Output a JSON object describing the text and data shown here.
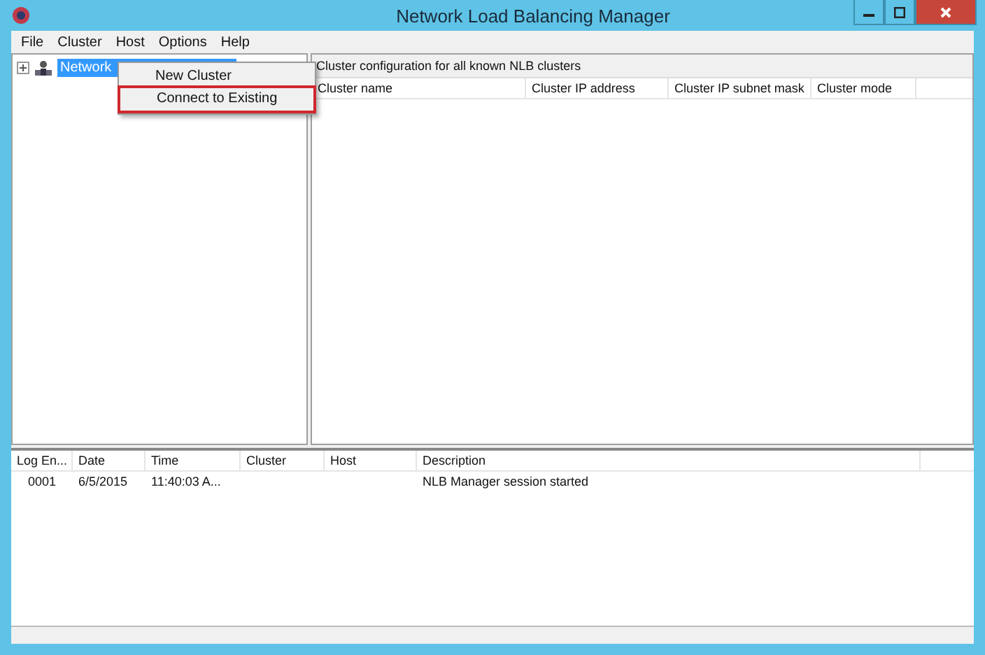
{
  "window": {
    "title": "Network Load Balancing Manager"
  },
  "menu_bar": [
    "File",
    "Cluster",
    "Host",
    "Options",
    "Help"
  ],
  "tree": {
    "items": [
      {
        "label": "Network",
        "selected": true,
        "expanded": false
      }
    ]
  },
  "context_menu": {
    "items": [
      {
        "label": "New Cluster",
        "annotated": false
      },
      {
        "label": "Connect to Existing",
        "annotated": true
      }
    ]
  },
  "cluster_panel": {
    "caption": "Cluster configuration for all known NLB clusters",
    "columns": [
      "Cluster name",
      "Cluster IP address",
      "Cluster IP subnet mask",
      "Cluster mode"
    ]
  },
  "log": {
    "columns": [
      "Log En...",
      "Date",
      "Time",
      "Cluster",
      "Host",
      "Description"
    ],
    "rows": [
      [
        "0001",
        "6/5/2015",
        "11:40:03 A...",
        "",
        "",
        "NLB Manager session started"
      ]
    ]
  }
}
